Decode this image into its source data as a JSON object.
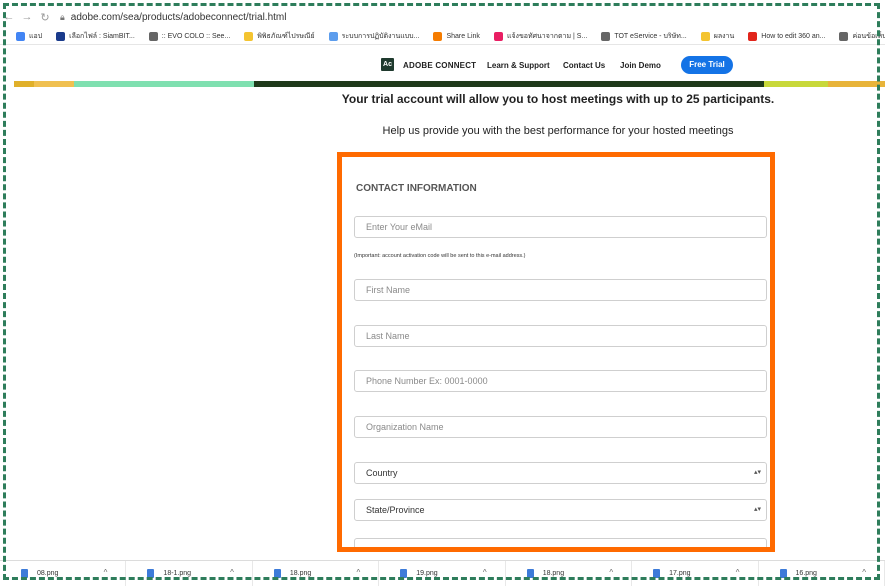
{
  "browser": {
    "url": "adobe.com/sea/products/adobeconnect/trial.html",
    "bookmarks": [
      {
        "label": "แอป",
        "icon": "apps-grid-icon",
        "color": "#4285f4"
      },
      {
        "label": "เลือกไฟล์ : SiamBIT...",
        "icon": "siambit-icon",
        "color": "#1a3b8c"
      },
      {
        "label": ":: EVO COLO :: See...",
        "icon": "globe-icon",
        "color": "#666666"
      },
      {
        "label": "พิพิธภัณฑ์ไปรษณีย์",
        "icon": "folder-icon",
        "color": "#f4c430"
      },
      {
        "label": "ระบบการปฏิบัติงานแบบ...",
        "icon": "app-icon",
        "color": "#5c9ded"
      },
      {
        "label": "Share Link",
        "icon": "share-link-icon",
        "color": "#f57c00"
      },
      {
        "label": "แจ้งขอทัศนาจากตาม | S...",
        "icon": "feed-icon",
        "color": "#e91e63"
      },
      {
        "label": "TOT eService - บริษัท...",
        "icon": "globe-icon",
        "color": "#666666"
      },
      {
        "label": "ผลงาน",
        "icon": "folder-icon",
        "color": "#f4c430"
      },
      {
        "label": "How to edit 360 an...",
        "icon": "adobe-icon",
        "color": "#e1251b"
      },
      {
        "label": "ค่อนข้อเห็นเว็บเชื่อกล้อง...",
        "icon": "globe-icon",
        "color": "#666666"
      },
      {
        "label": "Salaya webe",
        "icon": "salaya-icon",
        "color": "#c8a000"
      }
    ]
  },
  "header": {
    "brand": "ADOBE CONNECT",
    "nav": [
      "Learn & Support",
      "Contact Us",
      "Join Demo"
    ],
    "cta": "Free Trial"
  },
  "page": {
    "headline": "Your trial account will allow you to host meetings with up to 25 participants.",
    "subline": "Help us provide you with the best performance for your hosted meetings"
  },
  "form": {
    "section_title": "CONTACT INFORMATION",
    "email_placeholder": "Enter Your eMail",
    "email_note": "(Important: account activation code will be sent to this e-mail address.)",
    "first_name_placeholder": "First Name",
    "last_name_placeholder": "Last Name",
    "phone_placeholder": "Phone Number Ex: 0001-0000",
    "organization_placeholder": "Organization Name",
    "country_value": "Country",
    "state_value": "State/Province"
  },
  "downloads": [
    "08.png",
    "18-1.png",
    "18.png",
    "19.png",
    "18.png",
    "17.png",
    "16.png"
  ]
}
